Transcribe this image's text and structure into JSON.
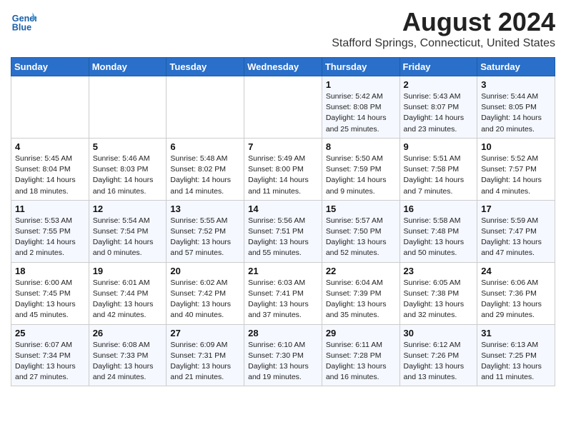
{
  "header": {
    "logo_general": "General",
    "logo_blue": "Blue",
    "month_title": "August 2024",
    "location": "Stafford Springs, Connecticut, United States"
  },
  "weekdays": [
    "Sunday",
    "Monday",
    "Tuesday",
    "Wednesday",
    "Thursday",
    "Friday",
    "Saturday"
  ],
  "weeks": [
    [
      {
        "day": "",
        "info": ""
      },
      {
        "day": "",
        "info": ""
      },
      {
        "day": "",
        "info": ""
      },
      {
        "day": "",
        "info": ""
      },
      {
        "day": "1",
        "info": "Sunrise: 5:42 AM\nSunset: 8:08 PM\nDaylight: 14 hours\nand 25 minutes."
      },
      {
        "day": "2",
        "info": "Sunrise: 5:43 AM\nSunset: 8:07 PM\nDaylight: 14 hours\nand 23 minutes."
      },
      {
        "day": "3",
        "info": "Sunrise: 5:44 AM\nSunset: 8:05 PM\nDaylight: 14 hours\nand 20 minutes."
      }
    ],
    [
      {
        "day": "4",
        "info": "Sunrise: 5:45 AM\nSunset: 8:04 PM\nDaylight: 14 hours\nand 18 minutes."
      },
      {
        "day": "5",
        "info": "Sunrise: 5:46 AM\nSunset: 8:03 PM\nDaylight: 14 hours\nand 16 minutes."
      },
      {
        "day": "6",
        "info": "Sunrise: 5:48 AM\nSunset: 8:02 PM\nDaylight: 14 hours\nand 14 minutes."
      },
      {
        "day": "7",
        "info": "Sunrise: 5:49 AM\nSunset: 8:00 PM\nDaylight: 14 hours\nand 11 minutes."
      },
      {
        "day": "8",
        "info": "Sunrise: 5:50 AM\nSunset: 7:59 PM\nDaylight: 14 hours\nand 9 minutes."
      },
      {
        "day": "9",
        "info": "Sunrise: 5:51 AM\nSunset: 7:58 PM\nDaylight: 14 hours\nand 7 minutes."
      },
      {
        "day": "10",
        "info": "Sunrise: 5:52 AM\nSunset: 7:57 PM\nDaylight: 14 hours\nand 4 minutes."
      }
    ],
    [
      {
        "day": "11",
        "info": "Sunrise: 5:53 AM\nSunset: 7:55 PM\nDaylight: 14 hours\nand 2 minutes."
      },
      {
        "day": "12",
        "info": "Sunrise: 5:54 AM\nSunset: 7:54 PM\nDaylight: 14 hours\nand 0 minutes."
      },
      {
        "day": "13",
        "info": "Sunrise: 5:55 AM\nSunset: 7:52 PM\nDaylight: 13 hours\nand 57 minutes."
      },
      {
        "day": "14",
        "info": "Sunrise: 5:56 AM\nSunset: 7:51 PM\nDaylight: 13 hours\nand 55 minutes."
      },
      {
        "day": "15",
        "info": "Sunrise: 5:57 AM\nSunset: 7:50 PM\nDaylight: 13 hours\nand 52 minutes."
      },
      {
        "day": "16",
        "info": "Sunrise: 5:58 AM\nSunset: 7:48 PM\nDaylight: 13 hours\nand 50 minutes."
      },
      {
        "day": "17",
        "info": "Sunrise: 5:59 AM\nSunset: 7:47 PM\nDaylight: 13 hours\nand 47 minutes."
      }
    ],
    [
      {
        "day": "18",
        "info": "Sunrise: 6:00 AM\nSunset: 7:45 PM\nDaylight: 13 hours\nand 45 minutes."
      },
      {
        "day": "19",
        "info": "Sunrise: 6:01 AM\nSunset: 7:44 PM\nDaylight: 13 hours\nand 42 minutes."
      },
      {
        "day": "20",
        "info": "Sunrise: 6:02 AM\nSunset: 7:42 PM\nDaylight: 13 hours\nand 40 minutes."
      },
      {
        "day": "21",
        "info": "Sunrise: 6:03 AM\nSunset: 7:41 PM\nDaylight: 13 hours\nand 37 minutes."
      },
      {
        "day": "22",
        "info": "Sunrise: 6:04 AM\nSunset: 7:39 PM\nDaylight: 13 hours\nand 35 minutes."
      },
      {
        "day": "23",
        "info": "Sunrise: 6:05 AM\nSunset: 7:38 PM\nDaylight: 13 hours\nand 32 minutes."
      },
      {
        "day": "24",
        "info": "Sunrise: 6:06 AM\nSunset: 7:36 PM\nDaylight: 13 hours\nand 29 minutes."
      }
    ],
    [
      {
        "day": "25",
        "info": "Sunrise: 6:07 AM\nSunset: 7:34 PM\nDaylight: 13 hours\nand 27 minutes."
      },
      {
        "day": "26",
        "info": "Sunrise: 6:08 AM\nSunset: 7:33 PM\nDaylight: 13 hours\nand 24 minutes."
      },
      {
        "day": "27",
        "info": "Sunrise: 6:09 AM\nSunset: 7:31 PM\nDaylight: 13 hours\nand 21 minutes."
      },
      {
        "day": "28",
        "info": "Sunrise: 6:10 AM\nSunset: 7:30 PM\nDaylight: 13 hours\nand 19 minutes."
      },
      {
        "day": "29",
        "info": "Sunrise: 6:11 AM\nSunset: 7:28 PM\nDaylight: 13 hours\nand 16 minutes."
      },
      {
        "day": "30",
        "info": "Sunrise: 6:12 AM\nSunset: 7:26 PM\nDaylight: 13 hours\nand 13 minutes."
      },
      {
        "day": "31",
        "info": "Sunrise: 6:13 AM\nSunset: 7:25 PM\nDaylight: 13 hours\nand 11 minutes."
      }
    ]
  ]
}
